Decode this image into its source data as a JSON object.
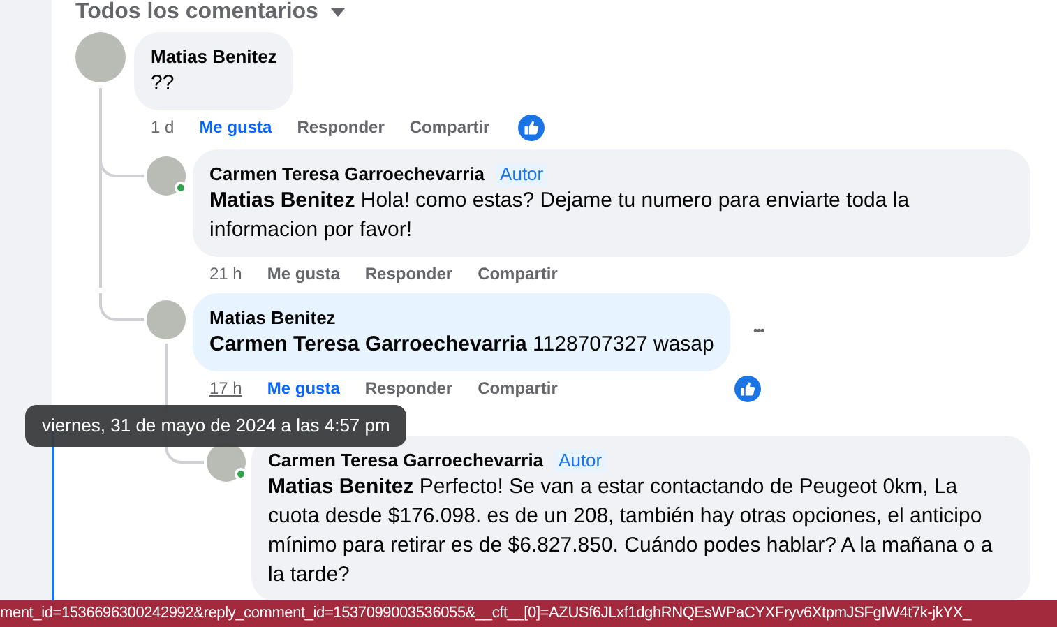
{
  "header": {
    "label": "Todos los comentarios"
  },
  "comments": [
    {
      "author": "Matias Benitez",
      "text": "??",
      "time": "1 d",
      "time_underlined": false,
      "like_label": "Me gusta",
      "liked": true,
      "reply_label": "Responder",
      "share_label": "Compartir",
      "reaction": true,
      "children": [
        {
          "author": "Carmen Teresa Garroechevarria",
          "badge": "Autor",
          "online": true,
          "mention": "Matias Benitez",
          "text": "Hola! como estas? Dejame tu numero para enviarte toda la informacion por favor!",
          "time": "21 h",
          "time_underlined": false,
          "like_label": "Me gusta",
          "liked": false,
          "reply_label": "Responder",
          "share_label": "Compartir"
        },
        {
          "author": "Matias Benitez",
          "highlighted": true,
          "mention": "Carmen Teresa Garroechevarria",
          "text": "1128707327 wasap",
          "menu": "•••",
          "time": "17 h",
          "time_underlined": true,
          "like_label": "Me gusta",
          "liked": true,
          "reply_label": "Responder",
          "share_label": "Compartir",
          "reaction": true,
          "children": [
            {
              "author": "Carmen Teresa Garroechevarria",
              "badge": "Autor",
              "online": true,
              "mention": "Matias Benitez",
              "text": "Perfecto! Se van a estar contactando de Peugeot 0km, La cuota desde $176.098. es de un 208, también hay otras opciones, el anticipo mínimo para retirar es de $6.827.850. Cuándo podes hablar? A la mañana o a la tarde?"
            }
          ]
        }
      ]
    }
  ],
  "tooltip": "viernes, 31 de mayo de 2024 a las 4:57 pm",
  "status_bar": "ment_id=1536696300242992&reply_comment_id=1537099003536055&__cft__[0]=AZUSf6JLxf1dghRNQEsWPaCYXFryv6XtpmJSFgIW4t7k-jkYX_"
}
